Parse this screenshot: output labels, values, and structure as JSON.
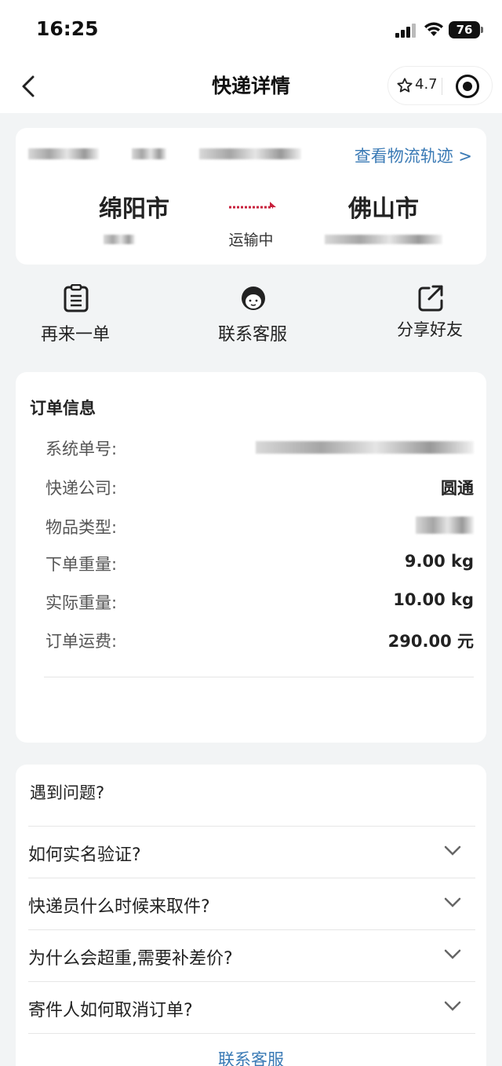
{
  "status_bar": {
    "time": "16:25",
    "battery": "76"
  },
  "nav": {
    "title": "快递详情",
    "rating": "4.7"
  },
  "route": {
    "track_link": "查看物流轨迹 >",
    "from_city": "绵阳市",
    "to_city": "佛山市",
    "status": "运输中"
  },
  "actions": [
    {
      "label": "再来一单",
      "icon": "clipboard-icon"
    },
    {
      "label": "联系客服",
      "icon": "customer-service-icon"
    },
    {
      "label": "分享好友",
      "icon": "share-icon"
    }
  ],
  "order": {
    "title": "订单信息",
    "rows": [
      {
        "label": "系统单号:",
        "value": ""
      },
      {
        "label": "快递公司:",
        "value": "圆通"
      },
      {
        "label": "物品类型:",
        "value": ""
      },
      {
        "label": "下单重量:",
        "value": "9.00 kg"
      },
      {
        "label": "实际重量:",
        "value": "10.00 kg"
      },
      {
        "label": "订单运费:",
        "value": "290.00 元"
      }
    ]
  },
  "faq": {
    "title": "遇到问题?",
    "items": [
      "如何实名验证?",
      "快递员什么时候来取件?",
      "为什么会超重,需要补差价?",
      "寄件人如何取消订单?"
    ],
    "contact": "联系客服"
  },
  "colors": {
    "link": "#3a7ab5",
    "route_arrow": "#c8203c",
    "background": "#f2f4f5"
  }
}
